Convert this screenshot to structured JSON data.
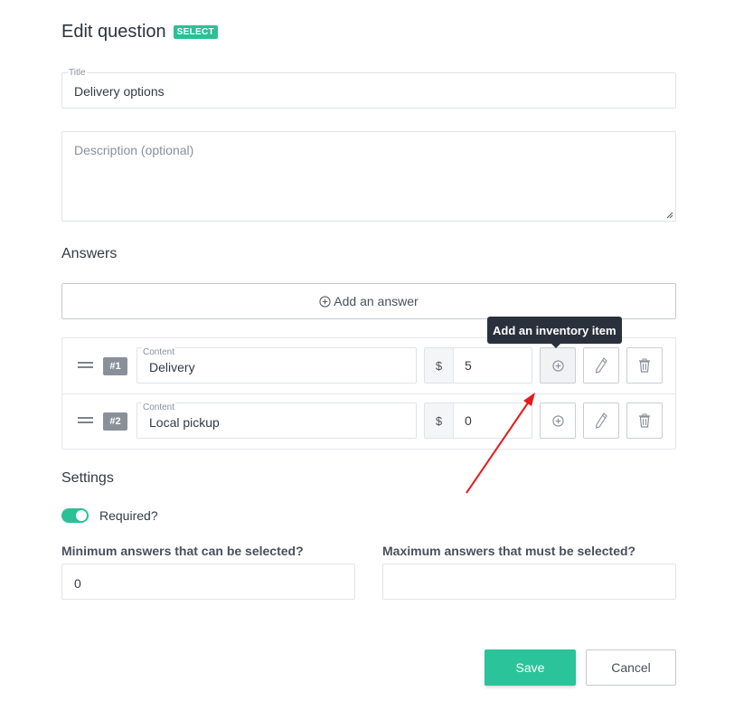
{
  "header": {
    "title": "Edit question",
    "badge": "SELECT"
  },
  "title_field": {
    "label": "Title",
    "value": "Delivery options"
  },
  "description_field": {
    "placeholder": "Description (optional)",
    "value": ""
  },
  "answers_section": {
    "heading": "Answers",
    "add_answer_label": "Add an answer",
    "add_icon": "plus-circle-icon",
    "items": [
      {
        "number": "#1",
        "content_label": "Content",
        "content": "Delivery",
        "currency": "$",
        "price": "5"
      },
      {
        "number": "#2",
        "content_label": "Content",
        "content": "Local pickup",
        "currency": "$",
        "price": "0"
      }
    ],
    "row_icons": [
      "plus-circle-icon",
      "pencil-icon",
      "trash-icon"
    ],
    "tooltip": "Add an inventory item"
  },
  "settings": {
    "heading": "Settings",
    "required_label": "Required?",
    "required_on": true,
    "min_label": "Minimum answers that can be selected?",
    "min_value": "0",
    "max_label": "Maximum answers that must be selected?",
    "max_value": ""
  },
  "footer": {
    "save_label": "Save",
    "cancel_label": "Cancel"
  },
  "colors": {
    "accent": "#2bc097",
    "tooltip_bg": "#2a313c",
    "annotation_arrow": "#e31b1b"
  }
}
